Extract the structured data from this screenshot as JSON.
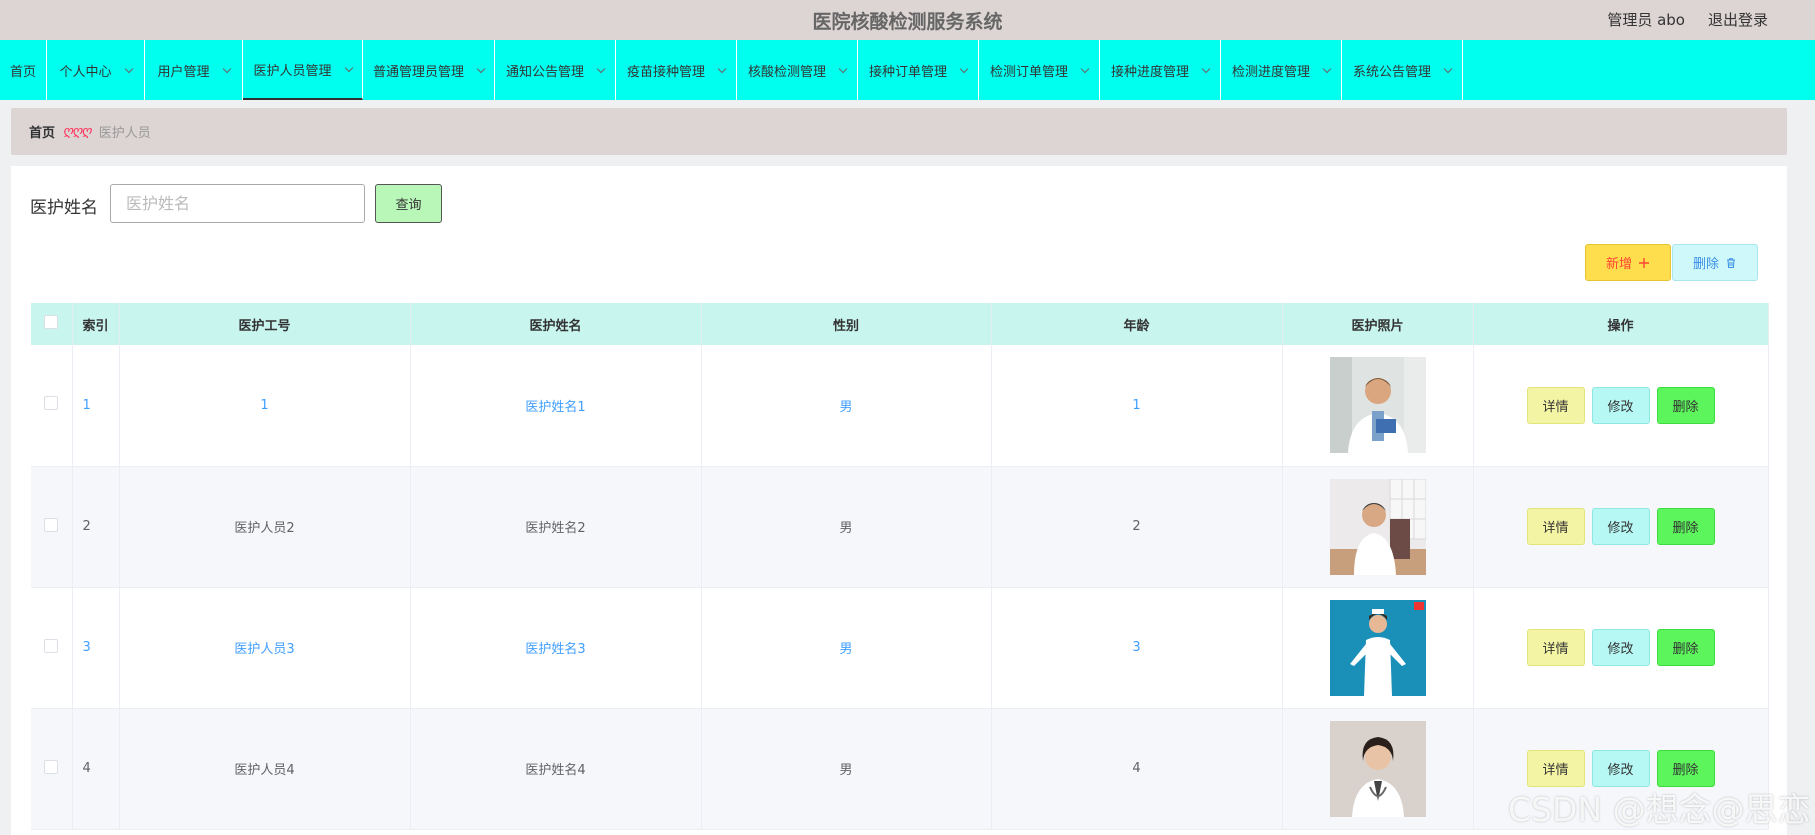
{
  "header": {
    "title": "医院核酸检测服务系统",
    "user": "管理员 abo",
    "logout": "退出登录"
  },
  "nav": {
    "items": [
      {
        "label": "首页"
      },
      {
        "label": "个人中心"
      },
      {
        "label": "用户管理"
      },
      {
        "label": "医护人员管理"
      },
      {
        "label": "普通管理员管理"
      },
      {
        "label": "通知公告管理"
      },
      {
        "label": "疫苗接种管理"
      },
      {
        "label": "核酸检测管理"
      },
      {
        "label": "接种订单管理"
      },
      {
        "label": "检测订单管理"
      },
      {
        "label": "接种进度管理"
      },
      {
        "label": "检测进度管理"
      },
      {
        "label": "系统公告管理"
      }
    ]
  },
  "breadcrumb": {
    "home": "首页",
    "separator": "ღღღ",
    "current": "医护人员"
  },
  "search": {
    "label": "医护姓名",
    "placeholder": "医护姓名",
    "button": "查询"
  },
  "actions": {
    "add": "新增",
    "add_icon": "plus-icon",
    "delete": "删除",
    "delete_icon": "trash-icon"
  },
  "table": {
    "headers": {
      "index": "索引",
      "staff_id": "医护工号",
      "name": "医护姓名",
      "gender": "性别",
      "age": "年龄",
      "photo": "医护照片",
      "ops": "操作"
    },
    "ops": {
      "detail": "详情",
      "edit": "修改",
      "delete": "删除"
    },
    "rows": [
      {
        "index": "1",
        "staff_id": "1",
        "name": "医护姓名1",
        "gender": "男",
        "age": "1"
      },
      {
        "index": "2",
        "staff_id": "医护人员2",
        "name": "医护姓名2",
        "gender": "男",
        "age": "2"
      },
      {
        "index": "3",
        "staff_id": "医护人员3",
        "name": "医护姓名3",
        "gender": "男",
        "age": "3"
      },
      {
        "index": "4",
        "staff_id": "医护人员4",
        "name": "医护姓名4",
        "gender": "男",
        "age": "4"
      }
    ]
  },
  "watermark": "CSDN @想念@思恋",
  "colors": {
    "nav_bg": "#00ffee",
    "header_bg": "#ddd4d4",
    "link": "#409eff",
    "table_header_bg": "#c8f5ee"
  }
}
